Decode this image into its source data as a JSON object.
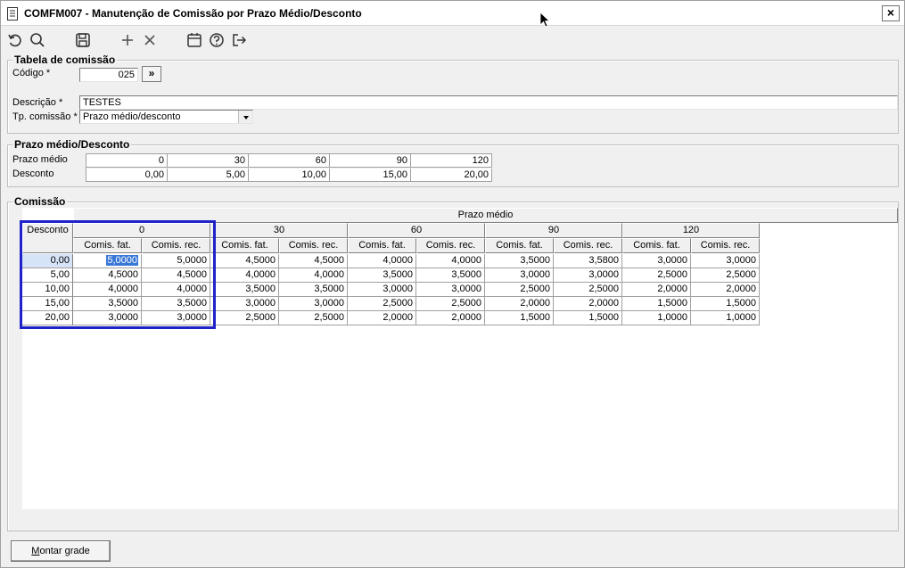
{
  "window": {
    "title": "COMFM007 - Manutenção de Comissão por Prazo Médio/Desconto",
    "close_label": "×"
  },
  "toolbar": {
    "icons": [
      "undo-icon",
      "search-icon",
      "save-icon",
      "add-icon",
      "delete-icon",
      "calendar-icon",
      "help-icon",
      "exit-icon"
    ]
  },
  "tabela": {
    "title": "Tabela de comissão",
    "codigo_label": "Código *",
    "codigo_value": "025",
    "lookup_label": "»",
    "descricao_label": "Descrição *",
    "descricao_value": "TESTES",
    "tipo_label": "Tp. comissão *",
    "tipo_value": "Prazo médio/desconto"
  },
  "prazo": {
    "title": "Prazo médio/Desconto",
    "prazo_label": "Prazo médio",
    "desconto_label": "Desconto",
    "prazo_values": [
      "0",
      "30",
      "60",
      "90",
      "120"
    ],
    "desconto_values": [
      "0,00",
      "5,00",
      "10,00",
      "15,00",
      "20,00"
    ]
  },
  "comissao": {
    "title": "Comissão",
    "super_header": "Prazo médio",
    "row_header": "Desconto",
    "prazo_headers": [
      "0",
      "30",
      "60",
      "90",
      "120"
    ],
    "sub_headers": [
      "Comis. fat.",
      "Comis. rec."
    ],
    "rows": [
      {
        "desconto": "0,00",
        "values": [
          "5,0000",
          "5,0000",
          "4,5000",
          "4,5000",
          "4,0000",
          "4,0000",
          "3,5000",
          "3,5800",
          "3,0000",
          "3,0000"
        ]
      },
      {
        "desconto": "5,00",
        "values": [
          "4,5000",
          "4,5000",
          "4,0000",
          "4,0000",
          "3,5000",
          "3,5000",
          "3,0000",
          "3,0000",
          "2,5000",
          "2,5000"
        ]
      },
      {
        "desconto": "10,00",
        "values": [
          "4,0000",
          "4,0000",
          "3,5000",
          "3,5000",
          "3,0000",
          "3,0000",
          "2,5000",
          "2,5000",
          "2,0000",
          "2,0000"
        ]
      },
      {
        "desconto": "15,00",
        "values": [
          "3,5000",
          "3,5000",
          "3,0000",
          "3,0000",
          "2,5000",
          "2,5000",
          "2,0000",
          "2,0000",
          "1,5000",
          "1,5000"
        ]
      },
      {
        "desconto": "20,00",
        "values": [
          "3,0000",
          "3,0000",
          "2,5000",
          "2,5000",
          "2,0000",
          "2,0000",
          "1,5000",
          "1,5000",
          "1,0000",
          "1,0000"
        ]
      }
    ],
    "selected_row": 0,
    "selected_col": 0,
    "highlight_color": "#1f22c8"
  },
  "footer": {
    "montar_label_first": "M",
    "montar_label_rest": "ontar grade"
  }
}
